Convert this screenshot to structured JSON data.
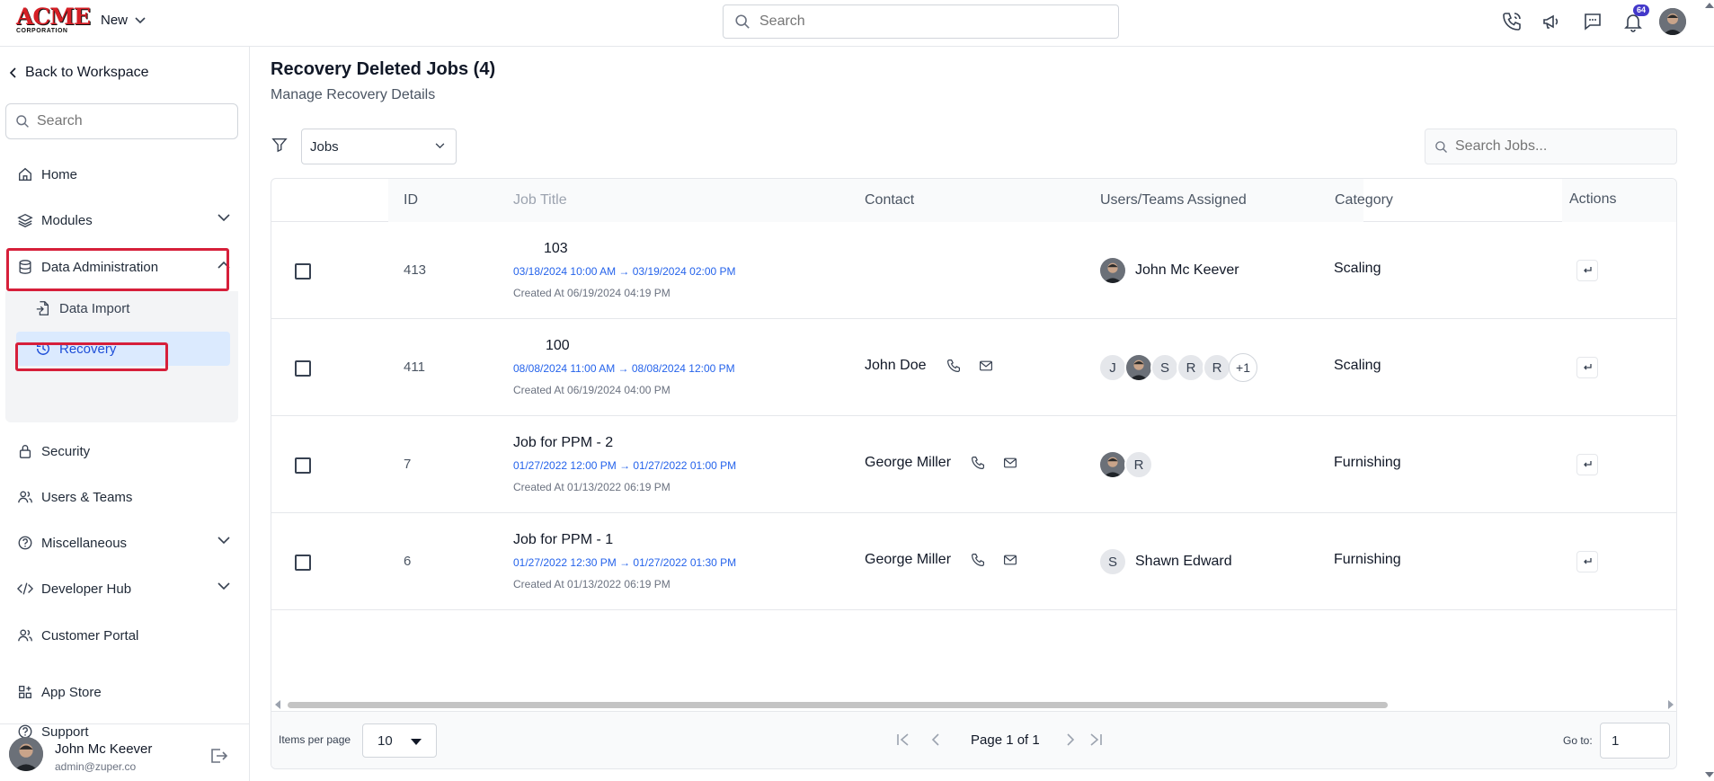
{
  "app": {
    "logo_main": "ACME",
    "logo_sub": "CORPORATION",
    "new_label": "New",
    "search_placeholder": "Search",
    "notification_count": "64"
  },
  "sidebar": {
    "back_label": "Back to Workspace",
    "search_placeholder": "Search",
    "items": [
      {
        "label": "Home",
        "icon": "home-icon"
      },
      {
        "label": "Modules",
        "icon": "layers-icon"
      },
      {
        "label": "Data Administration",
        "icon": "database-icon"
      },
      {
        "label": "Security",
        "icon": "lock-icon"
      },
      {
        "label": "Users & Teams",
        "icon": "users-icon"
      },
      {
        "label": "Miscellaneous",
        "icon": "help-circle-icon"
      },
      {
        "label": "Developer Hub",
        "icon": "code-icon"
      },
      {
        "label": "Customer Portal",
        "icon": "users-icon"
      },
      {
        "label": "App Store",
        "icon": "grid-plus-icon"
      },
      {
        "label": "Support",
        "icon": "help-circle-icon"
      }
    ],
    "sub_items": [
      {
        "label": "Data Import",
        "icon": "file-import-icon"
      },
      {
        "label": "Recovery",
        "icon": "history-icon"
      }
    ],
    "user": {
      "name": "John Mc Keever",
      "email": "admin@zuper.co"
    }
  },
  "main": {
    "title": "Recovery Deleted Jobs (4)",
    "subtitle": "Manage Recovery Details",
    "filter_value": "Jobs",
    "search_placeholder": "Search Jobs...",
    "columns": [
      "ID",
      "Job Title",
      "Contact",
      "Users/Teams Assigned",
      "Category",
      "Actions"
    ],
    "rows": [
      {
        "id": "413",
        "title": "103",
        "dates": "03/18/2024 10:00 AM → 03/19/2024 02:00 PM",
        "created": "Created At 06/19/2024 04:19 PM",
        "contact": "",
        "users_name": "John Mc Keever",
        "category": "Scaling"
      },
      {
        "id": "411",
        "title": "100",
        "dates": "08/08/2024 11:00 AM → 08/08/2024 12:00 PM",
        "created": "Created At 06/19/2024 04:00 PM",
        "contact": "John Doe",
        "users_initials": [
          "J",
          "S",
          "R",
          "R"
        ],
        "users_more": "+1",
        "category": "Scaling"
      },
      {
        "id": "7",
        "title": "Job for PPM - 2",
        "dates": "01/27/2022 12:00 PM → 01/27/2022 01:00 PM",
        "created": "Created At 01/13/2022 06:19 PM",
        "contact": "George Miller",
        "users_initials": [
          "R"
        ],
        "category": "Furnishing"
      },
      {
        "id": "6",
        "title": "Job for PPM - 1",
        "dates": "01/27/2022 12:30 PM → 01/27/2022 01:30 PM",
        "created": "Created At 01/13/2022 06:19 PM",
        "contact": "George Miller",
        "users_initials": [
          "S"
        ],
        "users_name": "Shawn Edward",
        "category": "Furnishing"
      }
    ],
    "pagination": {
      "items_per_page_label": "Items per page",
      "items_per_page": "10",
      "page_label": "Page 1 of 1",
      "goto_label": "Go to:",
      "goto_value": "1"
    }
  },
  "colors": {
    "accent_blue": "#2563eb",
    "highlight_red": "#d61f3a",
    "badge_indigo": "#4338ca",
    "logo_red": "#d61f26"
  }
}
